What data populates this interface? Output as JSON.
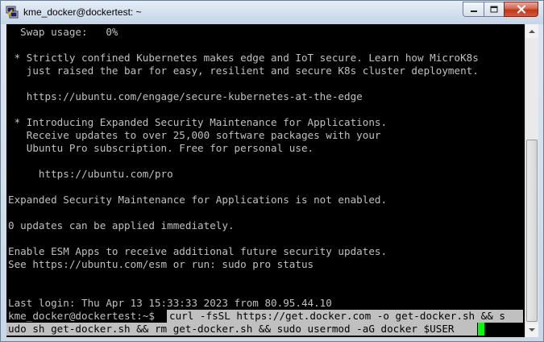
{
  "window": {
    "title": "kme_docker@dockertest: ~",
    "icon": "putty-icon",
    "controls": [
      "minimize-icon",
      "maximize-icon",
      "close-icon"
    ]
  },
  "terminal": {
    "lines": [
      "  Swap usage:   0%",
      "",
      " * Strictly confined Kubernetes makes edge and IoT secure. Learn how MicroK8s",
      "   just raised the bar for easy, resilient and secure K8s cluster deployment.",
      "",
      "   https://ubuntu.com/engage/secure-kubernetes-at-the-edge",
      "",
      " * Introducing Expanded Security Maintenance for Applications.",
      "   Receive updates to over 25,000 software packages with your",
      "   Ubuntu Pro subscription. Free for personal use.",
      "",
      "     https://ubuntu.com/pro",
      "",
      "Expanded Security Maintenance for Applications is not enabled.",
      "",
      "0 updates can be applied immediately.",
      "",
      "Enable ESM Apps to receive additional future security updates.",
      "See https://ubuntu.com/esm or run: sudo pro status",
      "",
      "",
      "Last login: Thu Apr 13 15:33:33 2023 from 80.95.44.10"
    ],
    "prompt": "kme_docker@dockertest:~$ ",
    "command_line1": "curl -fsSL https://get.docker.com -o get-docker.sh && s",
    "command_line2": "udo sh get-docker.sh && rm get-docker.sh && sudo usermod -aG docker $USER",
    "colors": {
      "background": "#000000",
      "text": "#c0c0c0",
      "selection": "#c0c0c0",
      "cursor": "#00ff00"
    }
  }
}
